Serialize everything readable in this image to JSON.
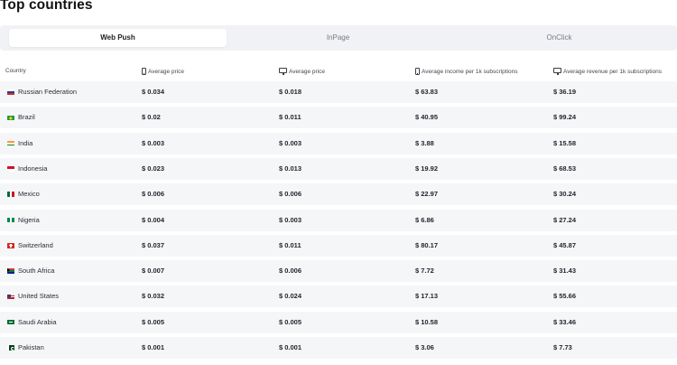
{
  "page": {
    "title": "Top countries"
  },
  "tabs": [
    {
      "label": "Web Push",
      "active": true
    },
    {
      "label": "InPage",
      "active": false
    },
    {
      "label": "OnClick",
      "active": false
    }
  ],
  "table": {
    "columns": [
      {
        "label": "Country",
        "icon": ""
      },
      {
        "label": "Average price",
        "icon": "mobile-icon"
      },
      {
        "label": "Average price",
        "icon": "desktop-icon"
      },
      {
        "label": "Average income per 1k subscriptions",
        "icon": "mobile-icon"
      },
      {
        "label": "Average revenue per 1k subscriptions",
        "icon": "desktop-icon"
      }
    ],
    "rows": [
      {
        "flag": "ru",
        "country": "Russian Federation",
        "mobile_price": "$ 0.034",
        "desktop_price": "$ 0.018",
        "mobile_income": "$ 63.83",
        "desktop_revenue": "$ 36.19"
      },
      {
        "flag": "br",
        "country": "Brazil",
        "mobile_price": "$ 0.02",
        "desktop_price": "$ 0.011",
        "mobile_income": "$ 40.95",
        "desktop_revenue": "$ 99.24"
      },
      {
        "flag": "in",
        "country": "India",
        "mobile_price": "$ 0.003",
        "desktop_price": "$ 0.003",
        "mobile_income": "$ 3.88",
        "desktop_revenue": "$ 15.58"
      },
      {
        "flag": "id",
        "country": "Indonesia",
        "mobile_price": "$ 0.023",
        "desktop_price": "$ 0.013",
        "mobile_income": "$ 19.92",
        "desktop_revenue": "$ 68.53"
      },
      {
        "flag": "mx",
        "country": "Mexico",
        "mobile_price": "$ 0.006",
        "desktop_price": "$ 0.006",
        "mobile_income": "$ 22.97",
        "desktop_revenue": "$ 30.24"
      },
      {
        "flag": "ng",
        "country": "Nigeria",
        "mobile_price": "$ 0.004",
        "desktop_price": "$ 0.003",
        "mobile_income": "$ 6.86",
        "desktop_revenue": "$ 27.24"
      },
      {
        "flag": "ch",
        "country": "Switzerland",
        "mobile_price": "$ 0.037",
        "desktop_price": "$ 0.011",
        "mobile_income": "$ 80.17",
        "desktop_revenue": "$ 45.87"
      },
      {
        "flag": "za",
        "country": "South Africa",
        "mobile_price": "$ 0.007",
        "desktop_price": "$ 0.006",
        "mobile_income": "$ 7.72",
        "desktop_revenue": "$ 31.43"
      },
      {
        "flag": "us",
        "country": "United States",
        "mobile_price": "$ 0.032",
        "desktop_price": "$ 0.024",
        "mobile_income": "$ 17.13",
        "desktop_revenue": "$ 55.66"
      },
      {
        "flag": "sa",
        "country": "Saudi Arabia",
        "mobile_price": "$ 0.005",
        "desktop_price": "$ 0.005",
        "mobile_income": "$ 10.58",
        "desktop_revenue": "$ 33.46"
      },
      {
        "flag": "pk",
        "country": "Pakistan",
        "mobile_price": "$ 0.001",
        "desktop_price": "$ 0.001",
        "mobile_income": "$ 3.06",
        "desktop_revenue": "$ 7.73"
      }
    ]
  }
}
